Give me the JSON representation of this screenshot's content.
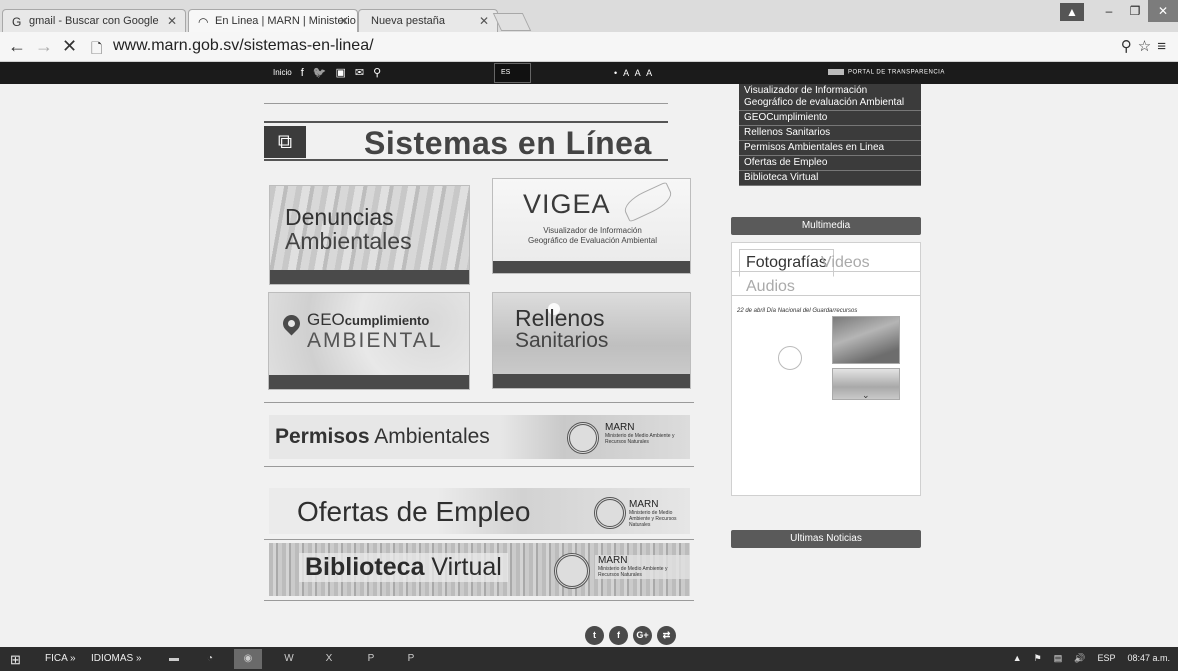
{
  "browser": {
    "tabs": [
      {
        "title": "gmail - Buscar con Google",
        "icon": "G",
        "active": false
      },
      {
        "title": "En Linea | MARN | Ministerio",
        "icon": "◠",
        "active": true
      },
      {
        "title": "Nueva pestaña",
        "icon": "",
        "active": false
      }
    ],
    "url": "www.marn.gob.sv/sistemas-en-linea/"
  },
  "site_bar": {
    "home": "Inicio",
    "lang": "ES",
    "sizes": "• A A A",
    "portal": "PORTAL DE TRANSPARENCIA"
  },
  "main": {
    "title": "Sistemas en Línea",
    "cards": {
      "denuncias": {
        "line1": "Denuncias",
        "line2": "Ambientales"
      },
      "vigea": {
        "title": "VIGEA",
        "sub1": "Visualizador de Información",
        "sub2": "Geográfico de Evaluación Ambiental"
      },
      "geo": {
        "geo": "GEO",
        "cumplimiento": "cumplimiento",
        "ambiental": "AMBIENTAL"
      },
      "rellenos": {
        "line1": "Rellenos",
        "line2": "Sanitarios"
      }
    },
    "banners": {
      "permisos": {
        "bold": "Permisos",
        "rest": " Ambientales",
        "marn": "MARN",
        "marn_sub": "Ministerio de Medio Ambiente y Recursos Naturales"
      },
      "ofertas": {
        "text": "Ofertas de Empleo",
        "marn": "MARN",
        "marn_sub": "Ministerio de Medio Ambiente y Recursos Naturales"
      },
      "biblioteca": {
        "bold": "Biblioteca",
        "rest": " Virtual",
        "marn": "MARN",
        "marn_sub": "Ministerio de Medio Ambiente y Recursos Naturales"
      }
    }
  },
  "sidebar": {
    "menu": [
      "Visualizador de Información Geográfico de evaluación Ambiental",
      "GEOCumplimiento",
      "Rellenos Sanitarios",
      "Permisos Ambientales en Linea",
      "Ofertas de Empleo",
      "Biblioteca Virtual"
    ],
    "multimedia": {
      "heading": "Multimedia",
      "tabs": [
        "Fotografías",
        "Videos",
        "Audios"
      ],
      "caption": "22 de abril Día Nacional del Guardarrecursos"
    },
    "news_heading": "Ultimas Noticias"
  },
  "taskbar": {
    "items": [
      "FICA",
      "IDIOMAS"
    ],
    "tray": {
      "lang": "ESP",
      "time": "08:47 a.m."
    }
  }
}
